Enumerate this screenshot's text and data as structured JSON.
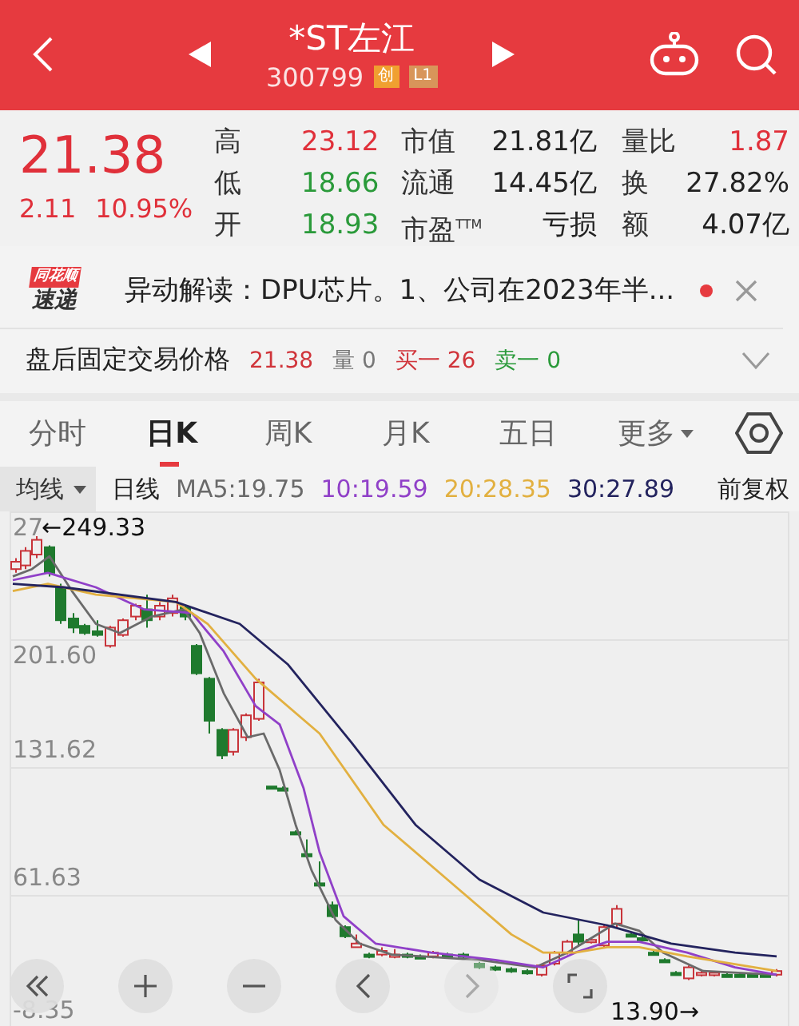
{
  "header": {
    "title": "*ST左江",
    "code": "300799",
    "badges": [
      {
        "label": "创",
        "color": "#f0a030"
      },
      {
        "label": "L1",
        "color": "#d8955a"
      }
    ]
  },
  "quote": {
    "price": "21.38",
    "change": "2.11",
    "change_percent": "10.95%",
    "color": "#e0303a",
    "stats": [
      [
        {
          "label": "高",
          "value": "23.12",
          "color": "#e0303a"
        },
        {
          "label": "低",
          "value": "18.66",
          "color": "#2a9a3a"
        },
        {
          "label": "开",
          "value": "18.93",
          "color": "#2a9a3a"
        }
      ],
      [
        {
          "label": "市值",
          "value": "21.81亿",
          "color": "#222222"
        },
        {
          "label": "流通",
          "value": "14.45亿",
          "color": "#222222"
        },
        {
          "label": "市盈$^{TTM}$",
          "value": "亏损",
          "color": "#222222"
        }
      ],
      [
        {
          "label": "量比",
          "value": "1.87",
          "color": "#e0303a"
        },
        {
          "label": "换",
          "value": "27.82%",
          "color": "#222222"
        },
        {
          "label": "额",
          "value": "4.07亿",
          "color": "#222222"
        }
      ]
    ]
  },
  "notice": {
    "logo": [
      "同花顺",
      "速递"
    ],
    "text": "异动解读：DPU芯片。1、公司在2023年半...",
    "unread": true
  },
  "after_hours": {
    "label": "盘后固定交易价格",
    "items": [
      {
        "text": "21.38",
        "color": "#d0343a"
      },
      {
        "text": "量 0",
        "color": "#777777"
      },
      {
        "text": "买一 26",
        "color": "#d0343a"
      },
      {
        "text": "卖一 0",
        "color": "#2a9a3a"
      }
    ],
    "expanded": false
  },
  "tabs": [
    {
      "label": "分时",
      "selected": false,
      "kind": "tab"
    },
    {
      "label": "日K",
      "selected": true,
      "kind": "tab"
    },
    {
      "label": "周K",
      "selected": false,
      "kind": "tab"
    },
    {
      "label": "月K",
      "selected": false,
      "kind": "tab"
    },
    {
      "label": "五日",
      "selected": false,
      "kind": "tab"
    },
    {
      "label": "更多",
      "selected": false,
      "kind": "menu"
    }
  ],
  "indicators": {
    "selector": "均线",
    "period": "日线",
    "ma": [
      {
        "label": "MA5:19.75",
        "color": "#6a6a6a"
      },
      {
        "label": "10:19.59",
        "color": "#9040c8"
      },
      {
        "label": "20:28.35",
        "color": "#e2b040"
      },
      {
        "label": "30:27.89",
        "color": "#23235e"
      }
    ],
    "adjust": "前复权"
  },
  "chart": {
    "y_labels": [
      "27",
      "201.60",
      "131.62",
      "61.63",
      "-8.35"
    ],
    "high_marker": "←249.33",
    "low_marker": "13.90→"
  },
  "controls": [
    {
      "kind": "rewind",
      "disabled": false
    },
    {
      "kind": "zoom-in",
      "disabled": false
    },
    {
      "kind": "zoom-out",
      "disabled": false
    },
    {
      "kind": "prev",
      "disabled": false
    },
    {
      "kind": "next",
      "disabled": true
    },
    {
      "kind": "fullscreen",
      "disabled": false
    }
  ]
}
